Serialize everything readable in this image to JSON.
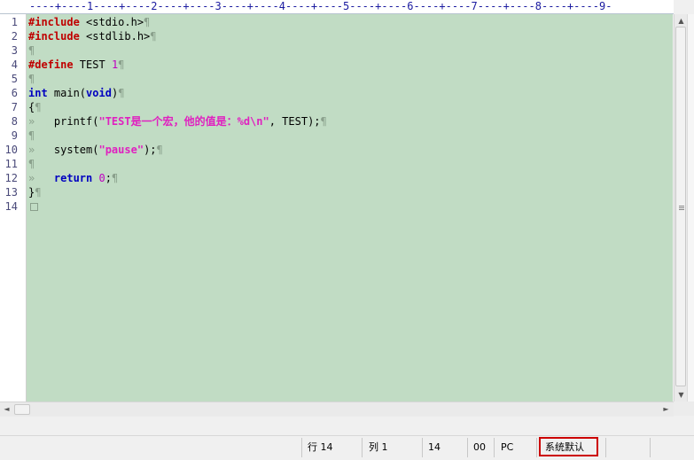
{
  "ruler": {
    "text": "----+----1----+----2----+----3----+----4----+----5----+----6----+----7----+----8----+----9-"
  },
  "line_numbers": [
    "1",
    "2",
    "3",
    "4",
    "5",
    "6",
    "7",
    "8",
    "9",
    "10",
    "11",
    "12",
    "13",
    "14"
  ],
  "code": {
    "l1_pp": "#include",
    "l1_rest": " <stdio.h>",
    "l2_pp": "#include",
    "l2_rest": " <stdlib.h>",
    "l4_pp": "#define",
    "l4_mid": " TEST ",
    "l4_num": "1",
    "l6_kw1": "int",
    "l6_mid": " main(",
    "l6_kw2": "void",
    "l6_end": ")",
    "l7": "{",
    "l8_a": "    printf(",
    "l8_str": "\"TEST是一个宏，他的值是：%d\\n\"",
    "l8_b": ", TEST);",
    "l10_a": "    system(",
    "l10_str": "\"pause\"",
    "l10_b": ");",
    "l12_a": "    ",
    "l12_kw": "return",
    "l12_mid": " ",
    "l12_num": "0",
    "l12_b": ";",
    "l13": "}"
  },
  "markers": {
    "pilcrow": "¶",
    "tab": "»"
  },
  "scrollbar": {
    "up": "▲",
    "down": "▼",
    "left": "◄",
    "right": "►"
  },
  "status": {
    "line": "行 14",
    "col": "列 1",
    "count": "14",
    "code": "00",
    "format": "PC",
    "encoding": "系统默认"
  }
}
